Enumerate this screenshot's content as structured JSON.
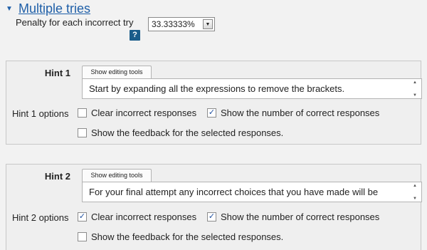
{
  "section": {
    "caret": "▼",
    "title": "Multiple tries"
  },
  "penalty": {
    "label": "Penalty for each incorrect try",
    "value": "33.33333%",
    "help": "?"
  },
  "hints": [
    {
      "label": "Hint 1",
      "tools_button": "Show editing tools",
      "text": "Start by expanding all the expressions to remove the brackets.",
      "options_label": "Hint 1 options",
      "clear_incorrect": {
        "label": "Clear incorrect responses",
        "checked": false
      },
      "show_number": {
        "label": "Show the number of correct responses",
        "checked": true
      },
      "show_feedback": {
        "label": "Show the feedback for the selected responses.",
        "checked": false
      }
    },
    {
      "label": "Hint 2",
      "tools_button": "Show editing tools",
      "text": "For your final attempt any incorrect choices that you have made will be",
      "options_label": "Hint 2 options",
      "clear_incorrect": {
        "label": "Clear incorrect responses",
        "checked": true
      },
      "show_number": {
        "label": "Show the number of correct responses",
        "checked": true
      },
      "show_feedback": {
        "label": "Show the feedback for the selected responses.",
        "checked": false
      }
    }
  ]
}
